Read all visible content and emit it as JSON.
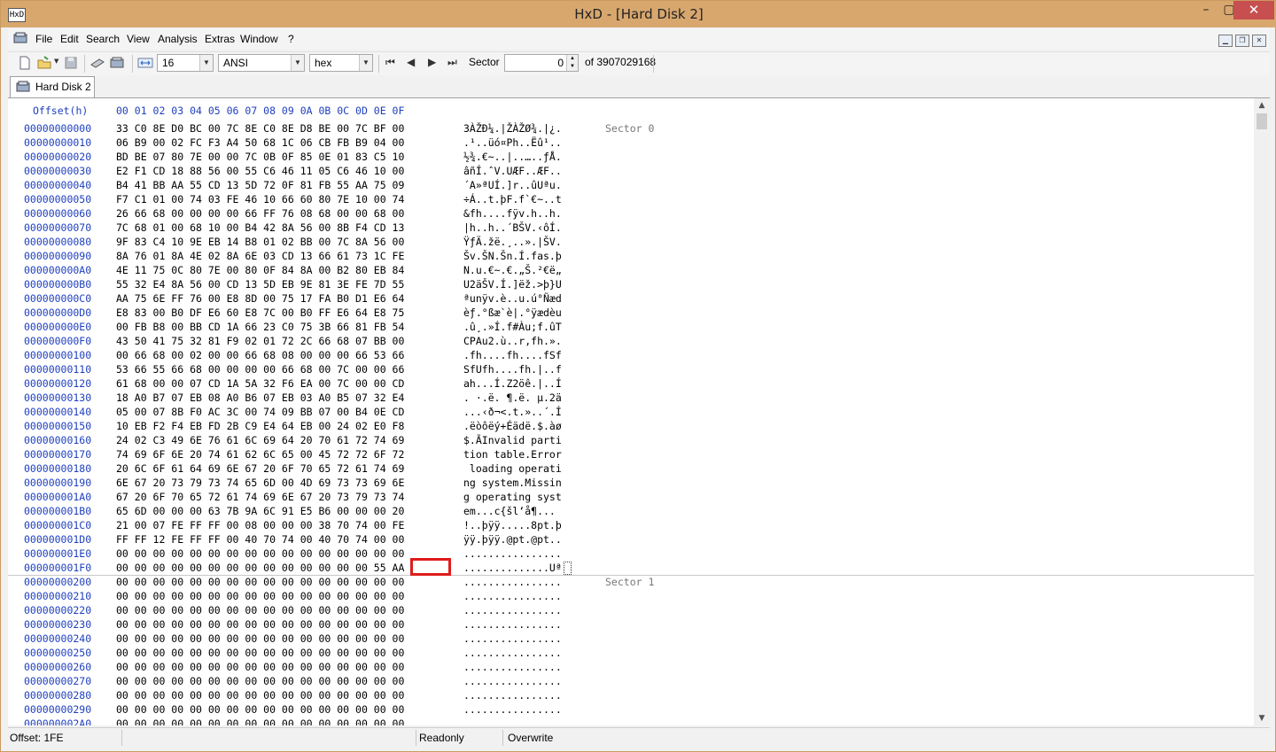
{
  "window": {
    "title": "HxD - [Hard Disk 2]",
    "app_icon": "HxD",
    "min": "–",
    "max": "▢",
    "close": "✕"
  },
  "menu": [
    "File",
    "Edit",
    "Search",
    "View",
    "Analysis",
    "Extras",
    "Window",
    "?"
  ],
  "toolbar": {
    "bytes_per_row": "16",
    "charset": "ANSI",
    "display": "hex",
    "sector_label": "Sector",
    "sector_value": "0",
    "sector_total": "of 3907029168"
  },
  "tab": {
    "label": "Hard Disk 2"
  },
  "header": {
    "offset": "Offset(h)",
    "columns": "00 01 02 03 04 05 06 07 08 09 0A 0B 0C 0D 0E 0F"
  },
  "sectors": [
    "Sector 0",
    "Sector 1"
  ],
  "rows": [
    {
      "o": "00000000000",
      "h": "33 C0 8E D0 BC 00 7C 8E C0 8E D8 BE 00 7C BF 00",
      "a": "3ÀŽÐ¼.|ŽÀŽØ¾.|¿."
    },
    {
      "o": "00000000010",
      "h": "06 B9 00 02 FC F3 A4 50 68 1C 06 CB FB B9 04 00",
      "a": ".¹..üó¤Ph..Ëû¹.."
    },
    {
      "o": "00000000020",
      "h": "BD BE 07 80 7E 00 00 7C 0B 0F 85 0E 01 83 C5 10",
      "a": "½¾.€~..|..…..ƒÅ."
    },
    {
      "o": "00000000030",
      "h": "E2 F1 CD 18 88 56 00 55 C6 46 11 05 C6 46 10 00",
      "a": "âñÍ.ˆV.UÆF..ÆF.."
    },
    {
      "o": "00000000040",
      "h": "B4 41 BB AA 55 CD 13 5D 72 0F 81 FB 55 AA 75 09",
      "a": "´A»ªUÍ.]r..ûUªu."
    },
    {
      "o": "00000000050",
      "h": "F7 C1 01 00 74 03 FE 46 10 66 60 80 7E 10 00 74",
      "a": "÷Á..t.þF.f`€~..t"
    },
    {
      "o": "00000000060",
      "h": "26 66 68 00 00 00 00 66 FF 76 08 68 00 00 68 00",
      "a": "&fh....fÿv.h..h."
    },
    {
      "o": "00000000070",
      "h": "7C 68 01 00 68 10 00 B4 42 8A 56 00 8B F4 CD 13",
      "a": "|h..h..´BŠV.‹ôÍ."
    },
    {
      "o": "00000000080",
      "h": "9F 83 C4 10 9E EB 14 B8 01 02 BB 00 7C 8A 56 00",
      "a": "ŸƒÄ.žë.¸..».|ŠV."
    },
    {
      "o": "00000000090",
      "h": "8A 76 01 8A 4E 02 8A 6E 03 CD 13 66 61 73 1C FE",
      "a": "Šv.ŠN.Šn.Í.fas.þ"
    },
    {
      "o": "000000000A0",
      "h": "4E 11 75 0C 80 7E 00 80 0F 84 8A 00 B2 80 EB 84",
      "a": "N.u.€~.€.„Š.²€ë„"
    },
    {
      "o": "000000000B0",
      "h": "55 32 E4 8A 56 00 CD 13 5D EB 9E 81 3E FE 7D 55",
      "a": "U2äŠV.Í.]ëž.>þ}U"
    },
    {
      "o": "000000000C0",
      "h": "AA 75 6E FF 76 00 E8 8D 00 75 17 FA B0 D1 E6 64",
      "a": "ªunÿv.è..u.ú°Ñæd"
    },
    {
      "o": "000000000D0",
      "h": "E8 83 00 B0 DF E6 60 E8 7C 00 B0 FF E6 64 E8 75",
      "a": "èƒ.°ßæ`è|.°ÿædèu"
    },
    {
      "o": "000000000E0",
      "h": "00 FB B8 00 BB CD 1A 66 23 C0 75 3B 66 81 FB 54",
      "a": ".û¸.»Í.f#Àu;f.ûT"
    },
    {
      "o": "000000000F0",
      "h": "43 50 41 75 32 81 F9 02 01 72 2C 66 68 07 BB 00",
      "a": "CPAu2.ù..r,fh.»."
    },
    {
      "o": "00000000100",
      "h": "00 66 68 00 02 00 00 66 68 08 00 00 00 66 53 66",
      "a": ".fh....fh....fSf"
    },
    {
      "o": "00000000110",
      "h": "53 66 55 66 68 00 00 00 00 66 68 00 7C 00 00 66",
      "a": "SfUfh....fh.|..f"
    },
    {
      "o": "00000000120",
      "h": "61 68 00 00 07 CD 1A 5A 32 F6 EA 00 7C 00 00 CD",
      "a": "ah...Í.Z2öê.|..Í"
    },
    {
      "o": "00000000130",
      "h": "18 A0 B7 07 EB 08 A0 B6 07 EB 03 A0 B5 07 32 E4",
      "a": ". ·.ë. ¶.ë. µ.2ä"
    },
    {
      "o": "00000000140",
      "h": "05 00 07 8B F0 AC 3C 00 74 09 BB 07 00 B4 0E CD",
      "a": "...‹ð¬<.t.»..´.Í"
    },
    {
      "o": "00000000150",
      "h": "10 EB F2 F4 EB FD 2B C9 E4 64 EB 00 24 02 E0 F8",
      "a": ".ëòôëý+Éädë.$.àø"
    },
    {
      "o": "00000000160",
      "h": "24 02 C3 49 6E 76 61 6C 69 64 20 70 61 72 74 69",
      "a": "$.ÃInvalid parti"
    },
    {
      "o": "00000000170",
      "h": "74 69 6F 6E 20 74 61 62 6C 65 00 45 72 72 6F 72",
      "a": "tion table.Error"
    },
    {
      "o": "00000000180",
      "h": "20 6C 6F 61 64 69 6E 67 20 6F 70 65 72 61 74 69",
      "a": " loading operati"
    },
    {
      "o": "00000000190",
      "h": "6E 67 20 73 79 73 74 65 6D 00 4D 69 73 73 69 6E",
      "a": "ng system.Missin"
    },
    {
      "o": "000000001A0",
      "h": "67 20 6F 70 65 72 61 74 69 6E 67 20 73 79 73 74",
      "a": "g operating syst"
    },
    {
      "o": "000000001B0",
      "h": "65 6D 00 00 00 63 7B 9A 6C 91 E5 B6 00 00 00 20",
      "a": "em...c{šl‘å¶..."
    },
    {
      "o": "000000001C0",
      "h": "21 00 07 FE FF FF 00 08 00 00 00 38 70 74 00 FE",
      "a": "!..þÿÿ.....8pt.þ"
    },
    {
      "o": "000000001D0",
      "h": "FF FF 12 FE FF FF 00 40 70 74 00 40 70 74 00 00",
      "a": "ÿÿ.þÿÿ.@pt.@pt.."
    },
    {
      "o": "000000001E0",
      "h": "00 00 00 00 00 00 00 00 00 00 00 00 00 00 00 00",
      "a": "................"
    },
    {
      "o": "000000001F0",
      "h": "00 00 00 00 00 00 00 00 00 00 00 00 00 00 55 AA",
      "a": "..............Uª"
    },
    {
      "o": "00000000200",
      "h": "00 00 00 00 00 00 00 00 00 00 00 00 00 00 00 00",
      "a": "................"
    },
    {
      "o": "00000000210",
      "h": "00 00 00 00 00 00 00 00 00 00 00 00 00 00 00 00",
      "a": "................"
    },
    {
      "o": "00000000220",
      "h": "00 00 00 00 00 00 00 00 00 00 00 00 00 00 00 00",
      "a": "................"
    },
    {
      "o": "00000000230",
      "h": "00 00 00 00 00 00 00 00 00 00 00 00 00 00 00 00",
      "a": "................"
    },
    {
      "o": "00000000240",
      "h": "00 00 00 00 00 00 00 00 00 00 00 00 00 00 00 00",
      "a": "................"
    },
    {
      "o": "00000000250",
      "h": "00 00 00 00 00 00 00 00 00 00 00 00 00 00 00 00",
      "a": "................"
    },
    {
      "o": "00000000260",
      "h": "00 00 00 00 00 00 00 00 00 00 00 00 00 00 00 00",
      "a": "................"
    },
    {
      "o": "00000000270",
      "h": "00 00 00 00 00 00 00 00 00 00 00 00 00 00 00 00",
      "a": "................"
    },
    {
      "o": "00000000280",
      "h": "00 00 00 00 00 00 00 00 00 00 00 00 00 00 00 00",
      "a": "................"
    },
    {
      "o": "00000000290",
      "h": "00 00 00 00 00 00 00 00 00 00 00 00 00 00 00 00",
      "a": "................"
    },
    {
      "o": "000000002A0",
      "h": "00 00 00 00 00 00 00 00 00 00 00 00 00 00 00 00",
      "a": "................"
    }
  ],
  "status": {
    "offset": "Offset: 1FE",
    "readonly": "Readonly",
    "mode": "Overwrite"
  },
  "colors": {
    "offset_blue": "#1f3fbf",
    "title_bar": "#d8a76e",
    "highlight": "#e01b1b"
  }
}
